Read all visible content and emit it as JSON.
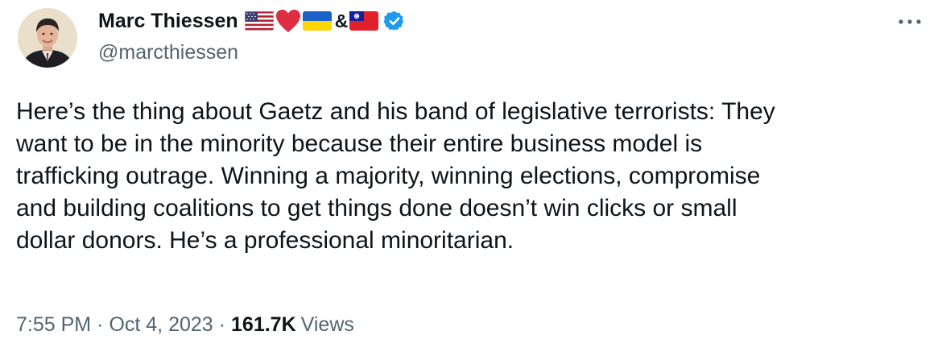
{
  "author": {
    "name": "Marc Thiessen",
    "handle": "@marcthiessen",
    "name_decorations": [
      "us-flag-icon",
      "red-heart-icon",
      "ukraine-flag-icon",
      "&",
      "taiwan-flag-icon"
    ],
    "verified": true,
    "verified_color": "#1d9bf0"
  },
  "tweet": {
    "text": "Here’s the thing about Gaetz and his band of legislative terrorists: They\nwant to be in the minority because their entire business model is\ntrafficking outrage. Winning a majority, winning elections, compromise\nand building coalitions to get things done doesn’t win clicks or small\ndollar donors. He’s a professional minoritarian.",
    "time": "7:55 PM",
    "separator": "·",
    "date": "Oct 4, 2023",
    "views_count": "161.7K",
    "views_label": "Views"
  },
  "more_icon": "more-horizontal-icon",
  "amp_text": "&",
  "colors": {
    "text": "#0f1419",
    "secondary": "#536471",
    "accent": "#1d9bf0"
  }
}
